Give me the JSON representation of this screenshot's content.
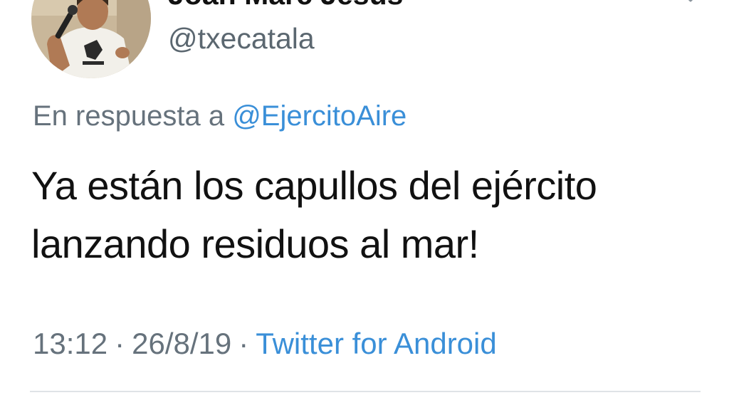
{
  "tweet": {
    "author": {
      "display_name": "Joan Marc Jesús",
      "username": "@txecatala",
      "avatar": "profile-photo"
    },
    "reply_prefix": "En respuesta a",
    "reply_to": "@EjercitoAire",
    "text_lines": [
      "Ya están los capullos del ejército",
      "lanzando residuos al mar!"
    ],
    "time": "13:12",
    "date": "26/8/19",
    "separator": "·",
    "source": "Twitter for Android"
  },
  "colors": {
    "link": "#3a8fd8",
    "secondary_text": "#66727c",
    "primary_text": "#111111",
    "divider": "#dfe3e7"
  },
  "icons": {
    "menu": "chevron-down-icon"
  }
}
